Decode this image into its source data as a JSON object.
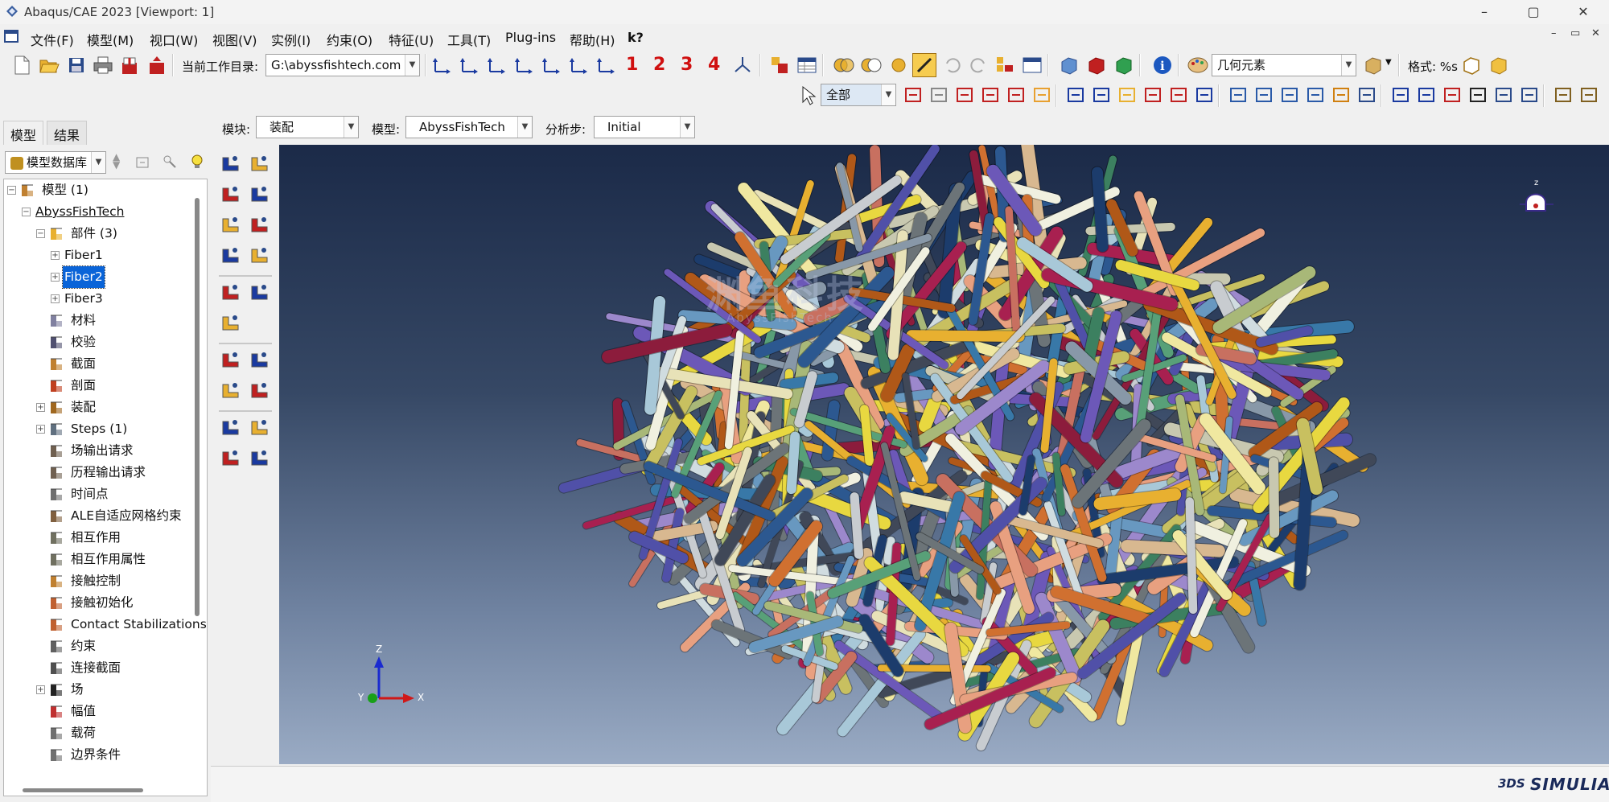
{
  "app": {
    "title": "Abaqus/CAE 2023 [Viewport: 1]",
    "window_controls": [
      "–",
      "▢",
      "✕"
    ],
    "mdi_controls": [
      "–",
      "▭",
      "✕"
    ]
  },
  "menu": [
    "文件(F)",
    "模型(M)",
    "视口(W)",
    "视图(V)",
    "实例(I)",
    "约束(O)",
    "特征(U)",
    "工具(T)",
    "Plug-ins",
    "帮助(H)",
    "k?"
  ],
  "toolbar1": {
    "workdir_label": "当前工作目录:",
    "workdir_value": "G:\\abyssfishtech.com",
    "view_numbers": [
      "1",
      "2",
      "3",
      "4"
    ],
    "geometry_combo": "几何元素",
    "format_label": "格式: %s"
  },
  "toolbar2": {
    "select_combo": "全部"
  },
  "context_bar": {
    "module_label": "模块:",
    "module_value": "装配",
    "model_label": "模型:",
    "model_value": "AbyssFishTech",
    "step_label": "分析步:",
    "step_value": "Initial"
  },
  "left_panel": {
    "tabs": [
      "模型",
      "结果"
    ],
    "db_combo": "模型数据库",
    "tree": [
      {
        "label": "模型 (1)",
        "level": 0,
        "exp": "⊟",
        "icon": "models"
      },
      {
        "label": "AbyssFishTech",
        "level": 1,
        "exp": "⊟",
        "icon": "none",
        "underline": true
      },
      {
        "label": "部件 (3)",
        "level": 2,
        "exp": "⊟",
        "icon": "parts"
      },
      {
        "label": "Fiber1",
        "level": 3,
        "exp": "⊞",
        "icon": "none"
      },
      {
        "label": "Fiber2",
        "level": 3,
        "exp": "⊞",
        "icon": "none",
        "selected": true
      },
      {
        "label": "Fiber3",
        "level": 3,
        "exp": "⊞",
        "icon": "none"
      },
      {
        "label": "材料",
        "level": 2,
        "exp": "",
        "icon": "materials"
      },
      {
        "label": "校验",
        "level": 2,
        "exp": "",
        "icon": "calibration"
      },
      {
        "label": "截面",
        "level": 2,
        "exp": "",
        "icon": "sections"
      },
      {
        "label": "剖面",
        "level": 2,
        "exp": "",
        "icon": "profiles"
      },
      {
        "label": "装配",
        "level": 2,
        "exp": "⊞",
        "icon": "assembly"
      },
      {
        "label": "Steps (1)",
        "level": 2,
        "exp": "⊞",
        "icon": "steps"
      },
      {
        "label": "场输出请求",
        "level": 2,
        "exp": "",
        "icon": "field-output"
      },
      {
        "label": "历程输出请求",
        "level": 2,
        "exp": "",
        "icon": "history-output"
      },
      {
        "label": "时间点",
        "level": 2,
        "exp": "",
        "icon": "time-points"
      },
      {
        "label": "ALE自适应网格约束",
        "level": 2,
        "exp": "",
        "icon": "ale"
      },
      {
        "label": "相互作用",
        "level": 2,
        "exp": "",
        "icon": "interactions"
      },
      {
        "label": "相互作用属性",
        "level": 2,
        "exp": "",
        "icon": "interaction-props"
      },
      {
        "label": "接触控制",
        "level": 2,
        "exp": "",
        "icon": "contact-controls"
      },
      {
        "label": "接触初始化",
        "level": 2,
        "exp": "",
        "icon": "contact-init"
      },
      {
        "label": "Contact Stabilizations",
        "level": 2,
        "exp": "",
        "icon": "contact-stab"
      },
      {
        "label": "约束",
        "level": 2,
        "exp": "",
        "icon": "constraints"
      },
      {
        "label": "连接截面",
        "level": 2,
        "exp": "",
        "icon": "connector-sections"
      },
      {
        "label": "场",
        "level": 2,
        "exp": "⊞",
        "icon": "fields"
      },
      {
        "label": "幅值",
        "level": 2,
        "exp": "",
        "icon": "amplitudes"
      },
      {
        "label": "载荷",
        "level": 2,
        "exp": "",
        "icon": "loads"
      },
      {
        "label": "边界条件",
        "level": 2,
        "exp": "",
        "icon": "bcs"
      }
    ]
  },
  "viewport": {
    "triad_labels": [
      "Z",
      "Y",
      "X"
    ],
    "compass_label": "z",
    "watermark_cn": "渊鱼科技",
    "watermark_en": "AbyssFishTech"
  },
  "status": {
    "brand": "SIMULIA",
    "brand_glyph": "3DS"
  },
  "colors": {
    "selection": "#0a64d8",
    "triad_z": "#1a2ad0",
    "triad_x": "#d01818",
    "triad_origin": "#18a018",
    "fiber_palette": [
      "#e8e2b8",
      "#f0e8a0",
      "#d8b890",
      "#e8a080",
      "#c87060",
      "#a82050",
      "#8c1c3c",
      "#5050a8",
      "#6c58b8",
      "#9c88cc",
      "#1c3c6c",
      "#2c5890",
      "#3878a8",
      "#6898c0",
      "#a8c8d8",
      "#d0dce0",
      "#c8ccd0",
      "#8898a8",
      "#404858",
      "#6c7478",
      "#3c8060",
      "#58a078",
      "#a8b878",
      "#c8c060",
      "#e8d840",
      "#e8b030",
      "#d07030",
      "#b05818",
      "#f0f0e0",
      "#c8c8b0"
    ]
  }
}
